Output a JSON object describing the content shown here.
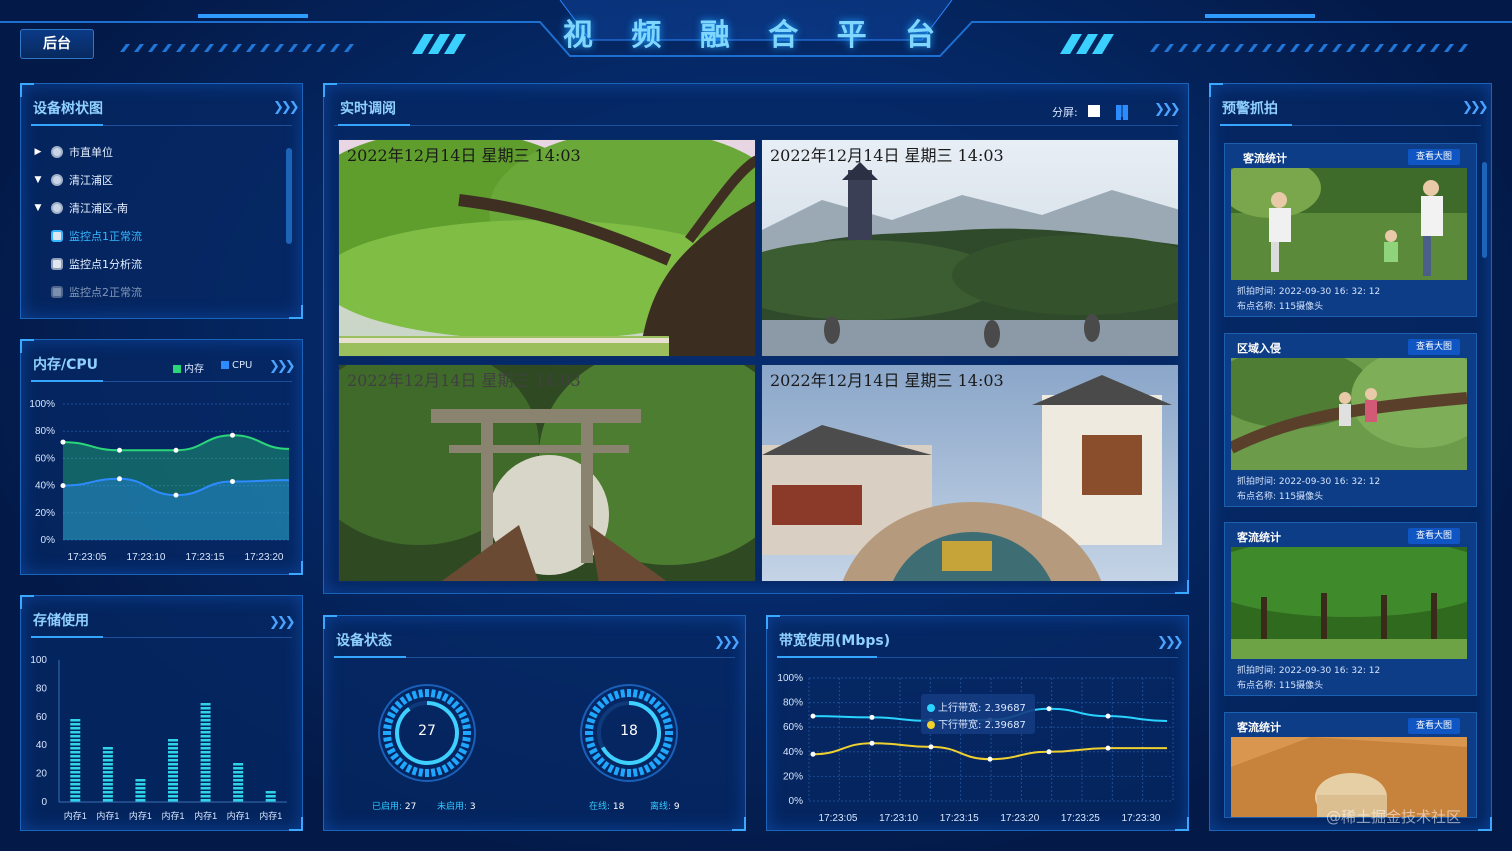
{
  "header": {
    "title": "视 频 融 合 平 台",
    "back_label": "后台"
  },
  "device_tree": {
    "title": "设备树状图",
    "items": [
      {
        "label": "市直单位",
        "type": "folder",
        "expanded": false
      },
      {
        "label": "清江浦区",
        "type": "folder",
        "expanded": true
      },
      {
        "label": "清江浦区-南",
        "type": "folder",
        "expanded": true
      },
      {
        "label": "监控点1正常流",
        "type": "camera",
        "selected": true
      },
      {
        "label": "监控点1分析流",
        "type": "camera",
        "selected": false
      },
      {
        "label": "监控点2正常流",
        "type": "camera",
        "selected": false
      }
    ]
  },
  "memcpu": {
    "title": "内存/CPU",
    "legend": [
      {
        "name": "内存",
        "color": "#2bd67b"
      },
      {
        "name": "CPU",
        "color": "#2e8bff"
      }
    ]
  },
  "storage": {
    "title": "存储使用"
  },
  "live": {
    "title": "实时调阅",
    "split_label": "分屏:"
  },
  "videos": [
    {
      "timestamp": "2022年12月14日 星期三 14:03"
    },
    {
      "timestamp": "2022年12月14日 星期三 14:03"
    },
    {
      "timestamp": "2022年12月14日 星期三 14:03"
    },
    {
      "timestamp": "2022年12月14日 星期三 14:03"
    }
  ],
  "device_status": {
    "title": "设备状态",
    "rings": [
      {
        "value": "27",
        "fraction": 0.9,
        "label_a": "已启用:",
        "val_a": "27",
        "label_b": "未启用:",
        "val_b": "3"
      },
      {
        "value": "18",
        "fraction": 0.67,
        "label_a": "在线:",
        "val_a": "18",
        "label_b": "离线:",
        "val_b": "9"
      }
    ]
  },
  "bandwidth": {
    "title": "带宽使用(Mbps)",
    "tooltip": [
      {
        "label": "上行带宽:",
        "value": "2.39687",
        "color": "#2ad4ff"
      },
      {
        "label": "下行带宽:",
        "value": "2.39687",
        "color": "#f0d030"
      }
    ]
  },
  "alerts": {
    "title": "预警抓拍",
    "cards": [
      {
        "title": "客流统计",
        "button": "查看大图",
        "time": "抓拍时间:  2022-09-30  16: 32: 12",
        "place": "布点名称:  115摄像头"
      },
      {
        "title": "区域入侵",
        "button": "查看大图",
        "time": "抓拍时间:  2022-09-30  16: 32: 12",
        "place": "布点名称:  115摄像头"
      },
      {
        "title": "客流统计",
        "button": "查看大图",
        "time": "抓拍时间:  2022-09-30  16: 32: 12",
        "place": "布点名称:  115摄像头"
      },
      {
        "title": "客流统计",
        "button": "查看大图",
        "time": "",
        "place": ""
      }
    ]
  },
  "watermark": "@稀土掘金技术社区",
  "chart_data": [
    {
      "type": "area",
      "title": "内存/CPU",
      "x": [
        "17:23:05",
        "17:23:10",
        "17:23:15",
        "17:23:20"
      ],
      "yticks": [
        "100%",
        "80%",
        "60%",
        "40%",
        "20%",
        "0%"
      ],
      "ylim": [
        0,
        100
      ],
      "x_points": [
        0,
        1,
        2,
        3,
        4
      ],
      "series": [
        {
          "name": "内存",
          "color": "#2bd67b",
          "values": [
            72,
            66,
            66,
            77,
            67
          ]
        },
        {
          "name": "CPU",
          "color": "#2e8bff",
          "values": [
            40,
            45,
            33,
            43,
            44
          ]
        }
      ]
    },
    {
      "type": "bar",
      "title": "存储使用",
      "categories": [
        "内存1",
        "内存1",
        "内存1",
        "内存1",
        "内存1",
        "内存1",
        "内存1"
      ],
      "values": [
        60,
        41,
        18,
        45,
        71,
        29,
        10
      ],
      "yticks": [
        "100",
        "80",
        "60",
        "40",
        "20",
        "0"
      ],
      "ylim": [
        0,
        100
      ],
      "color": "#2fd4e8"
    },
    {
      "type": "line",
      "title": "带宽使用(Mbps)",
      "x": [
        "17:23:05",
        "17:23:10",
        "17:23:15",
        "17:23:20",
        "17:23:25",
        "17:23:30"
      ],
      "yticks": [
        "100%",
        "80%",
        "60%",
        "40%",
        "20%",
        "0%"
      ],
      "ylim": [
        0,
        100
      ],
      "series": [
        {
          "name": "上行带宽",
          "color": "#2ad4ff",
          "values": [
            69,
            68,
            65,
            66,
            75,
            69,
            65
          ]
        },
        {
          "name": "下行带宽",
          "color": "#f0d030",
          "values": [
            38,
            47,
            44,
            34,
            40,
            43,
            43
          ]
        }
      ]
    }
  ]
}
